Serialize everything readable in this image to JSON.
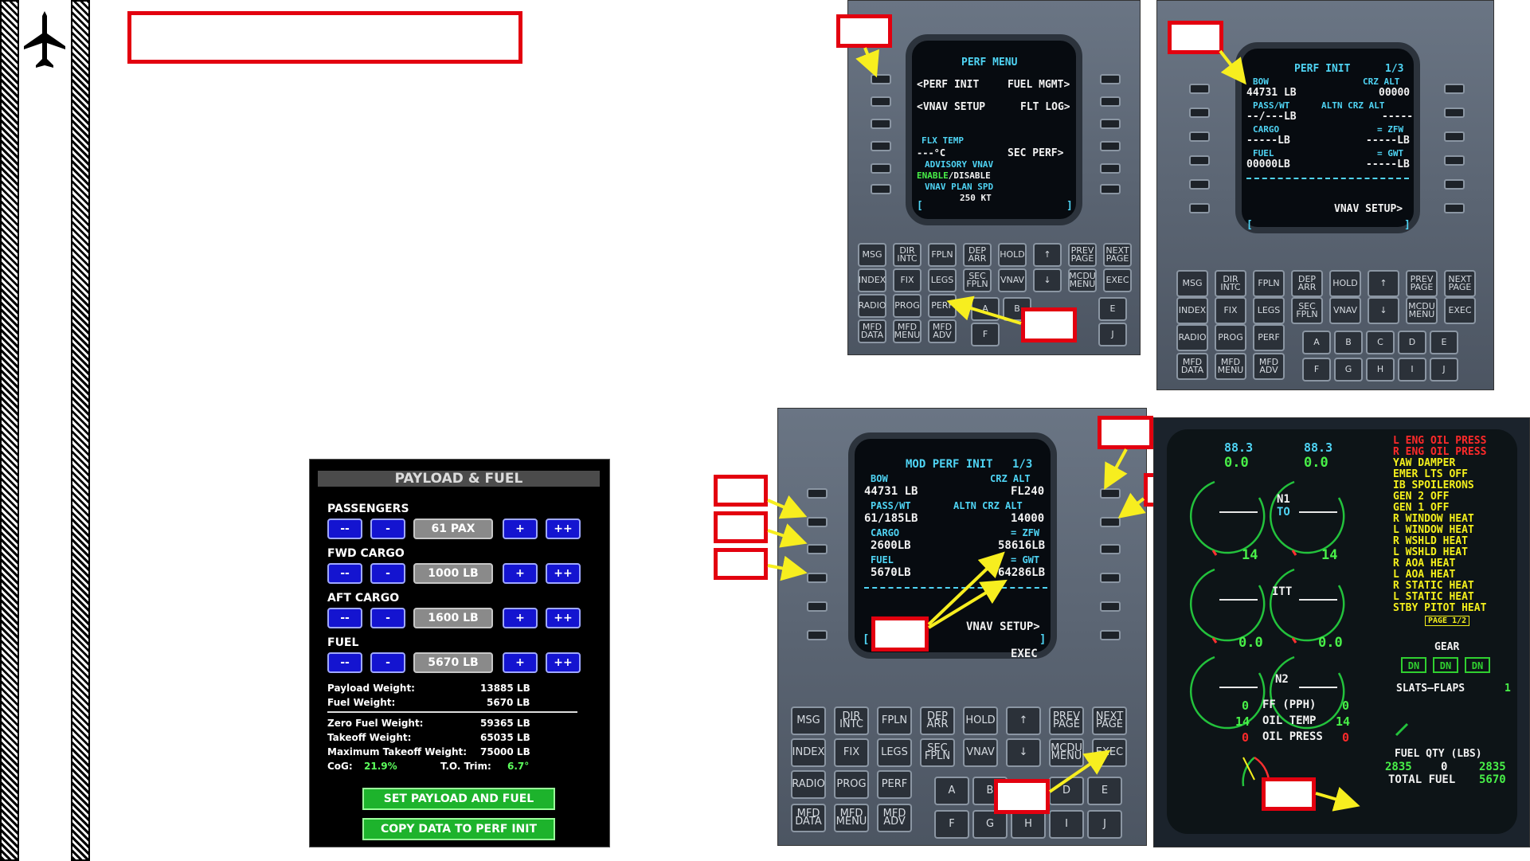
{
  "sidebar": {
    "icon": "airplane-icon"
  },
  "fmc_perf_menu": {
    "title": "PERF MENU",
    "rows": [
      {
        "left": "<PERF INIT",
        "right": "FUEL MGMT>"
      },
      {
        "left": "<VNAV SETUP",
        "right": "FLT LOG>"
      }
    ],
    "flx_label": "FLX TEMP",
    "flx_value": "---°C",
    "sec_perf": "SEC PERF>",
    "advisory": "ADVISORY VNAV",
    "enable": "ENABLE",
    "disable": "/DISABLE",
    "plan_spd": "VNAV PLAN SPD",
    "plan_spd_value": "250 KT",
    "bracket_l": "[",
    "bracket_r": "]"
  },
  "fmc_perf_init": {
    "title": "PERF INIT",
    "page": "1/3",
    "bow_label": "BOW",
    "bow_value": "44731 LB",
    "crz_label": "CRZ ALT",
    "crz_value": "00000",
    "pass_label": "PASS/WT",
    "pass_value": "--/---LB",
    "altn_label": "ALTN CRZ ALT",
    "altn_value": "-----",
    "cargo_label": "CARGO",
    "cargo_value": "-----LB",
    "zfw_label": "= ZFW",
    "zfw_value": "-----LB",
    "fuel_label": "FUEL",
    "fuel_value": "00000LB",
    "gwt_label": "= GWT",
    "gwt_value": "-----LB",
    "vnav": "VNAV SETUP>",
    "bracket_l": "[",
    "bracket_r": "]"
  },
  "fmc_mod": {
    "title": "MOD PERF INIT",
    "page": "1/3",
    "bow_label": "BOW",
    "bow_value": "44731 LB",
    "crz_label": "CRZ ALT",
    "crz_value": "FL240",
    "pass_label": "PASS/WT",
    "pass_value": "61/185LB",
    "altn_label": "ALTN CRZ ALT",
    "altn_value": "14000",
    "cargo_label": "CARGO",
    "cargo_value": "2600LB",
    "zfw_label": "= ZFW",
    "zfw_value": "58616LB",
    "fuel_label": "FUEL",
    "fuel_value": "5670LB",
    "gwt_label": "= GWT",
    "gwt_value": "64286LB",
    "vnav": "VNAV SETUP>",
    "exec": "EXEC",
    "bracket_l": "[",
    "bracket_r": "]"
  },
  "keys": {
    "row1": [
      "MSG",
      "DIR INTC",
      "FPLN",
      "DEP ARR",
      "HOLD",
      "↑",
      "PREV PAGE",
      "NEXT PAGE"
    ],
    "row2": [
      "INDEX",
      "FIX",
      "LEGS",
      "SEC FPLN",
      "VNAV",
      "↓",
      "MCDU MENU",
      "EXEC"
    ],
    "row3": [
      "RADIO",
      "PROG",
      "PERF"
    ],
    "row4": [
      "MFD DATA",
      "MFD MENU",
      "MFD ADV"
    ],
    "alpha1": [
      "A",
      "B",
      "C",
      "D",
      "E"
    ],
    "alpha2": [
      "F",
      "G",
      "H",
      "I",
      "J"
    ]
  },
  "payload": {
    "title": "PAYLOAD & FUEL",
    "sections": [
      {
        "label": "PASSENGERS",
        "value": "61 PAX"
      },
      {
        "label": "FWD CARGO",
        "value": "1000 LB"
      },
      {
        "label": "AFT CARGO",
        "value": "1600 LB"
      },
      {
        "label": "FUEL",
        "value": "5670 LB"
      }
    ],
    "dec2": "--",
    "dec1": "-",
    "inc1": "+",
    "inc2": "++",
    "payload_weight_label": "Payload Weight:",
    "payload_weight": "13885 LB",
    "fuel_weight_label": "Fuel Weight:",
    "fuel_weight": "5670 LB",
    "zfw_label": "Zero Fuel Weight:",
    "zfw": "59365 LB",
    "tow_label": "Takeoff Weight:",
    "tow": "65035 LB",
    "mtow_label": "Maximum Takeoff Weight:",
    "mtow": "75000 LB",
    "cog_label": "CoG:",
    "cog": "21.9%",
    "trim_label": "T.O. Trim:",
    "trim": "6.7°",
    "btn_set": "SET PAYLOAD AND FUEL",
    "btn_copy": "COPY DATA TO PERF INIT"
  },
  "eicas": {
    "n1_l": "88.3",
    "n1_r": "88.3",
    "n1_l_val": "0.0",
    "n1_r_val": "0.0",
    "n1_label": "N1",
    "to_label": "TO",
    "itt_l": "14",
    "itt_r": "14",
    "itt_label": "ITT",
    "n2_l": "0.0",
    "n2_r": "0.0",
    "n2_label": "N2",
    "ff_l": "0",
    "ff_label": "FF (PPH)",
    "ff_r": "0",
    "oilt_l": "14",
    "oilt_label": "OIL TEMP",
    "oilt_r": "14",
    "oilp_l": "0",
    "oilp_label": "OIL PRESS",
    "oilp_r": "0",
    "warnings": [
      "L ENG OIL PRESS",
      "R ENG OIL PRESS"
    ],
    "cautions": [
      "YAW DAMPER",
      "EMER LTS OFF",
      "IB SPOILERONS",
      "GEN 2 OFF",
      "GEN 1 OFF",
      "R WINDOW HEAT",
      "L WINDOW HEAT",
      "R WSHLD HEAT",
      "L WSHLD HEAT",
      "R AOA HEAT",
      "L AOA HEAT",
      "R STATIC HEAT",
      "L STATIC HEAT",
      "STBY PITOT HEAT"
    ],
    "page": "PAGE 1/2",
    "gear_label": "GEAR",
    "gear": [
      "DN",
      "DN",
      "DN"
    ],
    "slats_label": "SLATS–FLAPS",
    "slats_val": "1",
    "fuel_label": "FUEL QTY (LBS)",
    "fuel_l": "2835",
    "fuel_c": "0",
    "fuel_r": "2835",
    "total_label": "TOTAL FUEL",
    "total": "5670"
  }
}
